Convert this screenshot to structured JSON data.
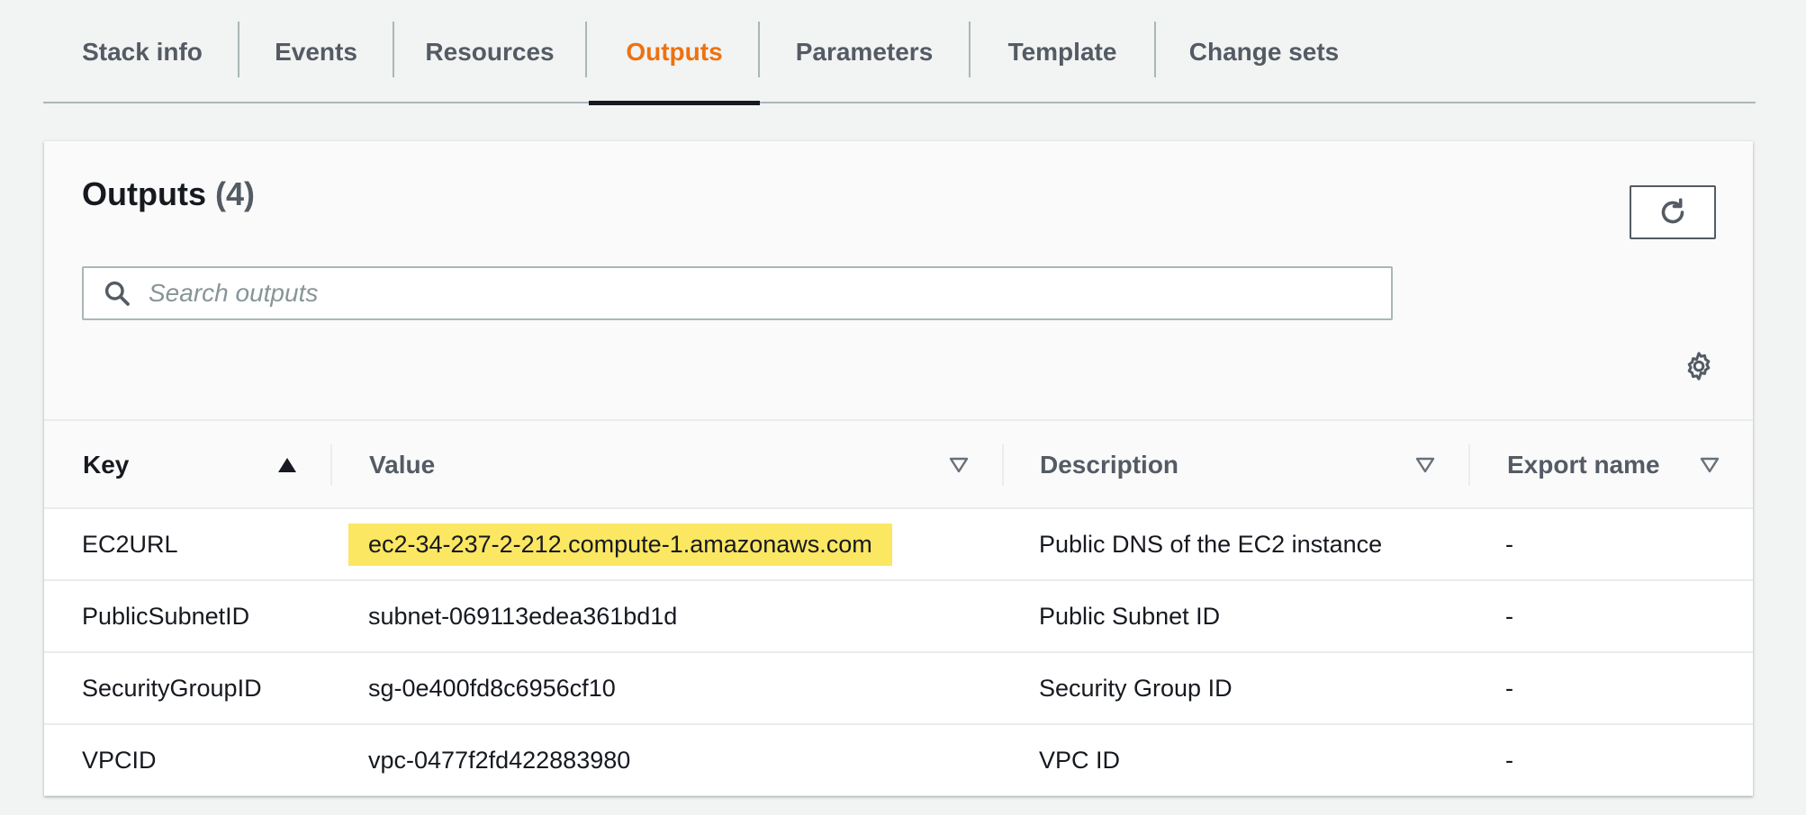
{
  "tabs": [
    {
      "label": "Stack info",
      "active": false
    },
    {
      "label": "Events",
      "active": false
    },
    {
      "label": "Resources",
      "active": false
    },
    {
      "label": "Outputs",
      "active": true
    },
    {
      "label": "Parameters",
      "active": false
    },
    {
      "label": "Template",
      "active": false
    },
    {
      "label": "Change sets",
      "active": false
    }
  ],
  "panel": {
    "title": "Outputs",
    "count": "(4)",
    "refresh_icon": "refresh-icon",
    "settings_icon": "gear-icon"
  },
  "search": {
    "placeholder": "Search outputs",
    "value": "",
    "icon": "search-icon"
  },
  "table": {
    "columns": [
      {
        "label": "Key",
        "sort": "ascending"
      },
      {
        "label": "Value",
        "sort": "none"
      },
      {
        "label": "Description",
        "sort": "none"
      },
      {
        "label": "Export name",
        "sort": "none"
      }
    ],
    "rows": [
      {
        "key": "EC2URL",
        "value": "ec2-34-237-2-212.compute-1.amazonaws.com",
        "description": "Public DNS of the EC2 instance",
        "export": "-",
        "highlighted": true
      },
      {
        "key": "PublicSubnetID",
        "value": "subnet-069113edea361bd1d",
        "description": "Public Subnet ID",
        "export": "-",
        "highlighted": false
      },
      {
        "key": "SecurityGroupID",
        "value": "sg-0e400fd8c6956cf10",
        "description": "Security Group ID",
        "export": "-",
        "highlighted": false
      },
      {
        "key": "VPCID",
        "value": "vpc-0477f2fd422883980",
        "description": "VPC ID",
        "export": "-",
        "highlighted": false
      }
    ]
  },
  "colors": {
    "accent": "#ec7211",
    "highlight": "#fbe762",
    "text": "#16191f",
    "muted": "#545b64",
    "border": "#aab7b8",
    "background": "#f2f3f3"
  }
}
